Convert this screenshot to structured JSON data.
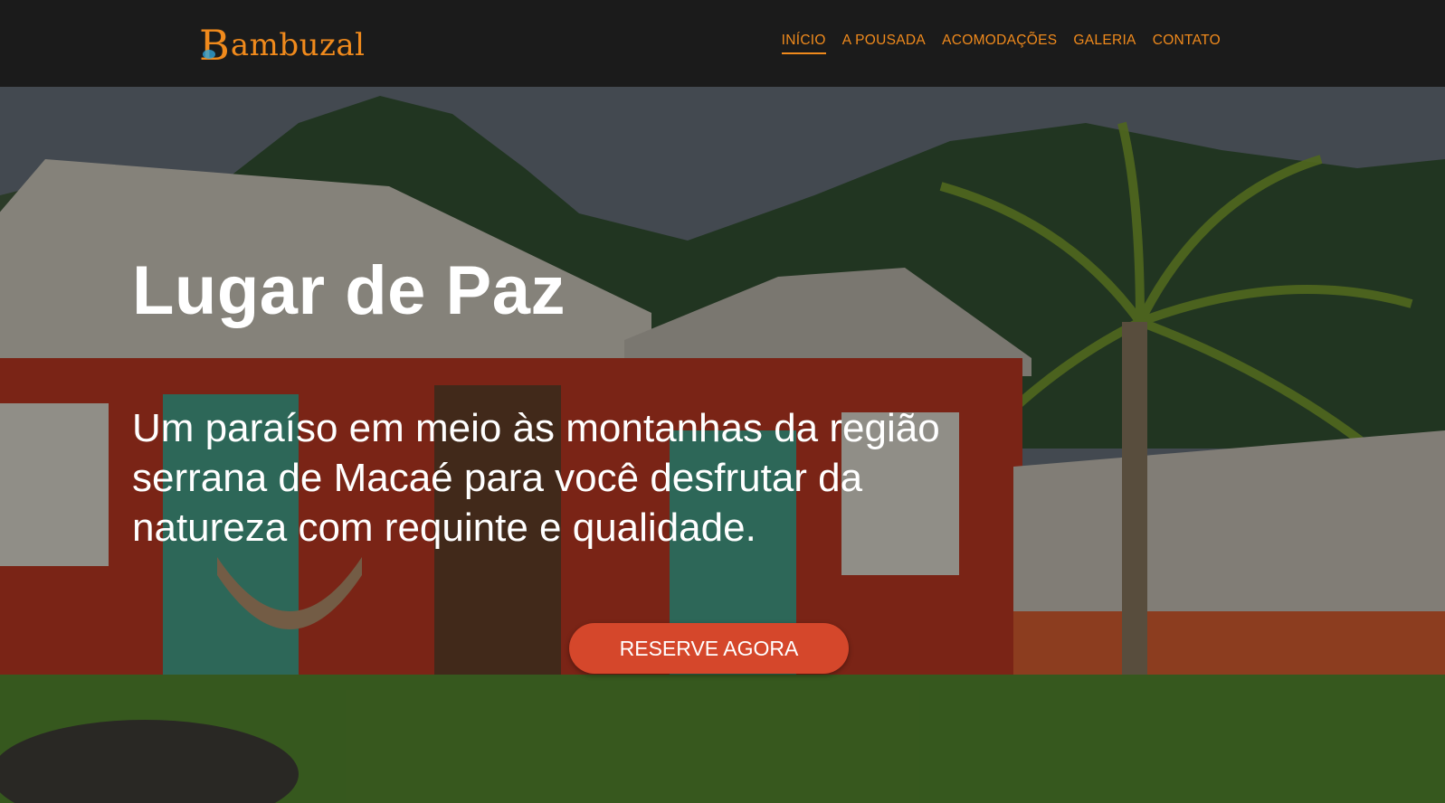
{
  "brand": {
    "logo_initial": "B",
    "logo_rest": "ambuzal",
    "accent": "#f08a1c"
  },
  "nav": {
    "items": [
      {
        "label": "INÍCIO",
        "active": true
      },
      {
        "label": "A POUSADA"
      },
      {
        "label": "ACOMODAÇÕES"
      },
      {
        "label": "GALERIA"
      },
      {
        "label": "CONTATO"
      }
    ]
  },
  "hero": {
    "title": "Lugar de Paz",
    "subtitle": "Um paraíso em meio às montanhas da região serrana de Macaé para você desfrutar da natureza com requinte e qualidade.",
    "cta_label": "RESERVE AGORA",
    "cta_color": "#d5472b"
  }
}
